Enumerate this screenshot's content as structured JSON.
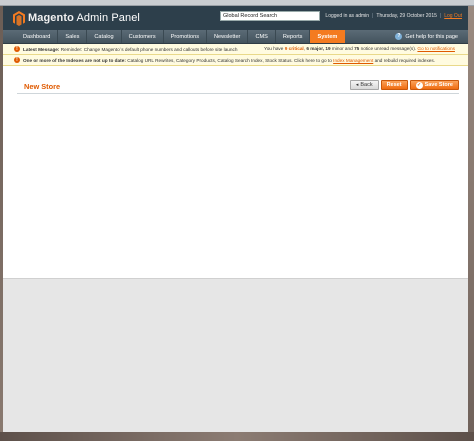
{
  "header": {
    "logo_brand": "Magento",
    "logo_suffix": "Admin Panel",
    "search_value": "Global Record Search",
    "logged_in": "Logged in as admin",
    "date": "Thursday, 29 October 2015",
    "logout": "Log Out"
  },
  "nav": {
    "items": [
      {
        "label": "Dashboard"
      },
      {
        "label": "Sales"
      },
      {
        "label": "Catalog"
      },
      {
        "label": "Customers"
      },
      {
        "label": "Promotions"
      },
      {
        "label": "Newsletter"
      },
      {
        "label": "CMS"
      },
      {
        "label": "Reports"
      },
      {
        "label": "System"
      }
    ],
    "active": "System",
    "help": "Get help for this page"
  },
  "notices": {
    "latest_label": "Latest Message:",
    "latest_text": "Reminder: Change Magento`s default phone numbers and callouts before site launch",
    "unread_prefix": "You have",
    "critical_num": "9 critical",
    "major": "6 major,",
    "minor_num": "19",
    "minor_text": "minor and",
    "notice_num": "75",
    "unread_suffix": "notice unread message(s).",
    "goto_notifications": "Go to notifications",
    "index_label": "One or more of the Indexes are not up to date:",
    "index_text": "Catalog URL Rewrites, Category Products, Catalog Search Index, Stock Status. Click here to go to",
    "index_link": "Index Management",
    "index_suffix": "and rebuild required indexes."
  },
  "content": {
    "title": "New Store",
    "back_label": "Back",
    "reset_label": "Reset",
    "save_label": "Save Store"
  },
  "colors": {
    "accent": "#f47b20",
    "header_bg": "#2d3f4b",
    "notice_bg": "#fffbe0"
  }
}
